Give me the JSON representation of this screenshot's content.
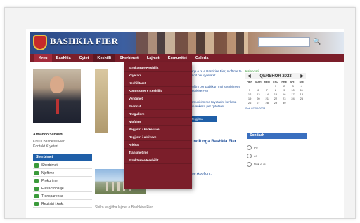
{
  "site": {
    "title": "BASHKIA FIER"
  },
  "search": {
    "placeholder": ""
  },
  "nav": {
    "items": [
      "Kreu",
      "Bashkia",
      "Cytet",
      "Keshilli",
      "Sherbimet",
      "Lajmet",
      "Komunitet",
      "Galeria"
    ]
  },
  "dropdown": {
    "items": [
      "Struktura e Keshillit",
      "Kryetari",
      "Keshilltaret",
      "Komisionet e Keshillit",
      "Vendimet",
      "Seancat",
      "Rregullore",
      "Njoftime",
      "Regjistri i kerkesave",
      "Regjistri i aktiveve",
      "Arkiva",
      "Transmetime",
      "Struktura e Keshillit"
    ]
  },
  "profile": {
    "name": "Armando Subashi",
    "role_line1": "Kreu i Bashkise Fier",
    "role_line2": "Kontakt Kryetari"
  },
  "sidebar": {
    "header": "Sherbimet",
    "items": [
      "Sherbimet",
      "Njoftime",
      "Prokurime",
      "Ftesa/Shpallje",
      "Transparenca",
      "Regjistri i Ank."
    ]
  },
  "mid_links": {
    "link1": "Faqe e re e Bashkise Fier, njoftime te fundit per qytetaret",
    "link2": "Njoftim per publikun mbi sherbimet e Bashkise Fier",
    "link3": "Komunikim me Kryetarin, kerkesa dhe ankesa per qytetaret",
    "button": "Te gjitha"
  },
  "calendar": {
    "label": "Kalendari",
    "month": "QERSHOR 2023",
    "day_names": [
      "HËN",
      "MAR",
      "MËR",
      "ENJ",
      "PRE",
      "SHT",
      "DIE"
    ],
    "weeks": [
      [
        "",
        "",
        "",
        "1",
        "2",
        "3",
        "4"
      ],
      [
        "5",
        "6",
        "7",
        "8",
        "9",
        "10",
        "11"
      ],
      [
        "12",
        "13",
        "14",
        "15",
        "16",
        "17",
        "18"
      ],
      [
        "19",
        "20",
        "21",
        "22",
        "23",
        "24",
        "25"
      ],
      [
        "26",
        "27",
        "28",
        "29",
        "30",
        "",
        ""
      ]
    ],
    "footer": "Sot: 07/06/2023"
  },
  "poll": {
    "header": "Sondazh",
    "options": [
      "Po",
      "Jo",
      "Nuk e di"
    ]
  },
  "news": {
    "title": "Lajmi i fundit nga Bashkia Fier",
    "item_text": "Mbi dhjete mijë vizitore ne Apolloni, Fier",
    "bottom_text": "Shiko te gjitha lajmet e Bashkise Fier"
  }
}
